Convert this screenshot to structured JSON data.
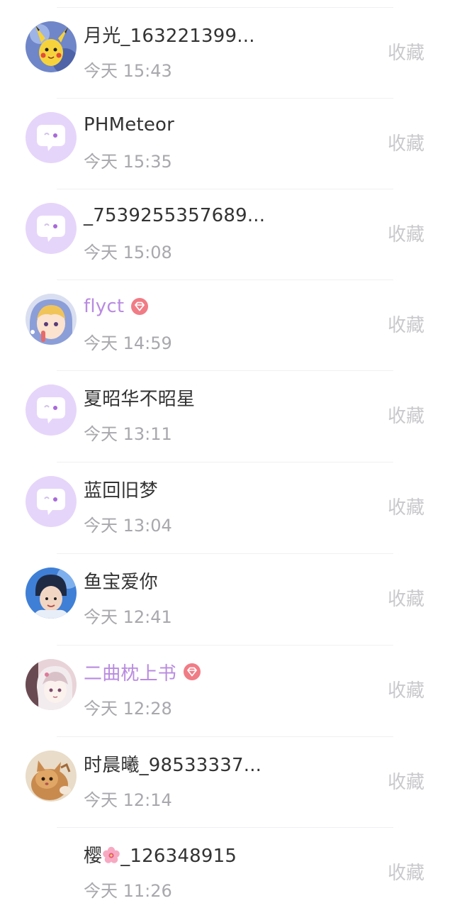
{
  "colors": {
    "name_text": "#333333",
    "vip_name_text": "#b98be0",
    "time_text": "#a8a8ad",
    "favorite_text": "#c9c9cd",
    "default_avatar_bg": "#e6d5fa",
    "vip_badge": "#f07c86"
  },
  "list": {
    "items": [
      {
        "name": "月光_163221399...",
        "vip": false,
        "avatar_icon": "pikachu-avatar",
        "time": "今天 15:43",
        "action_label": "收藏"
      },
      {
        "name": "PHMeteor",
        "vip": false,
        "avatar_icon": "default-chat-bubble-avatar",
        "time": "今天 15:35",
        "action_label": "收藏"
      },
      {
        "name": "_7539255357689...",
        "vip": false,
        "avatar_icon": "default-chat-bubble-avatar",
        "time": "今天 15:08",
        "action_label": "收藏"
      },
      {
        "name": "flyct",
        "vip": true,
        "vip_icon": "diamond-vip-icon",
        "avatar_icon": "anime-girl-avatar",
        "time": "今天 14:59",
        "action_label": "收藏"
      },
      {
        "name": "夏昭华不昭星",
        "vip": false,
        "avatar_icon": "default-chat-bubble-avatar",
        "time": "今天 13:11",
        "action_label": "收藏"
      },
      {
        "name": "蓝回旧梦",
        "vip": false,
        "avatar_icon": "default-chat-bubble-avatar",
        "time": "今天 13:04",
        "action_label": "收藏"
      },
      {
        "name": "鱼宝爱你",
        "vip": false,
        "avatar_icon": "photo-person-avatar",
        "time": "今天 12:41",
        "action_label": "收藏"
      },
      {
        "name": "二曲枕上书",
        "vip": true,
        "vip_icon": "diamond-vip-icon",
        "avatar_icon": "anime-girl-pink-avatar",
        "time": "今天 12:28",
        "action_label": "收藏"
      },
      {
        "name": "时晨曦_98533337...",
        "vip": false,
        "avatar_icon": "kitten-avatar",
        "time": "今天 12:14",
        "action_label": "收藏"
      },
      {
        "name_prefix": "樱",
        "name_icon": "cherry-blossom-emoji",
        "name_suffix": "_126348915",
        "vip": false,
        "avatar_icon": "blank-avatar",
        "time": "今天 11:26",
        "action_label": "收藏"
      }
    ]
  }
}
